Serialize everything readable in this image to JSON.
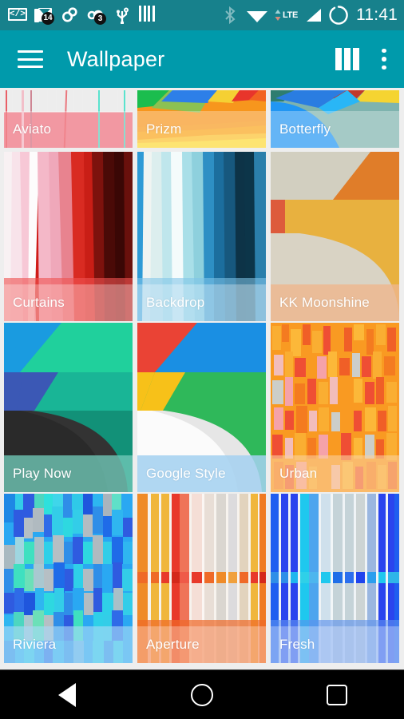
{
  "statusbar": {
    "icons_left": [
      {
        "name": "code-brackets-icon",
        "glyph": "</>"
      },
      {
        "name": "mail-stack-icon",
        "badge": "14"
      },
      {
        "name": "sync-circles-icon",
        "badge": ""
      },
      {
        "name": "location-dot-icon",
        "badge": "3"
      },
      {
        "name": "usb-icon",
        "badge": ""
      },
      {
        "name": "equalizer-bars-icon",
        "badge": ""
      }
    ],
    "icons_right": [
      {
        "name": "bluetooth-icon"
      },
      {
        "name": "wifi-icon"
      },
      {
        "name": "data-transfer-icon"
      },
      {
        "name": "lte-label",
        "text": "LTE"
      },
      {
        "name": "signal-icon"
      },
      {
        "name": "battery-circle-icon"
      }
    ],
    "clock": "11:41"
  },
  "appbar": {
    "title": "Wallpaper",
    "menu_label": "navigation-drawer",
    "columns_label": "column-layout",
    "overflow_label": "more-options",
    "background": "#009aab"
  },
  "grid": {
    "columns": 3,
    "wallpapers": [
      {
        "name": "Aviato",
        "label": "Aviato"
      },
      {
        "name": "Prizm",
        "label": "Prizm"
      },
      {
        "name": "Botterfly",
        "label": "Botterfly"
      },
      {
        "name": "Curtains",
        "label": "Curtains"
      },
      {
        "name": "Backdrop",
        "label": "Backdrop"
      },
      {
        "name": "KK Moonshine",
        "label": "KK Moonshine"
      },
      {
        "name": "Play Now",
        "label": "Play Now"
      },
      {
        "name": "Google Style",
        "label": "Google Style"
      },
      {
        "name": "Urban",
        "label": "Urban"
      },
      {
        "name": "Riviera",
        "label": "Riviera"
      },
      {
        "name": "Aperture",
        "label": "Aperture"
      },
      {
        "name": "Fresh",
        "label": "Fresh"
      }
    ]
  },
  "navbar": {
    "back": "back-button",
    "home": "home-button",
    "recents": "recents-button"
  }
}
